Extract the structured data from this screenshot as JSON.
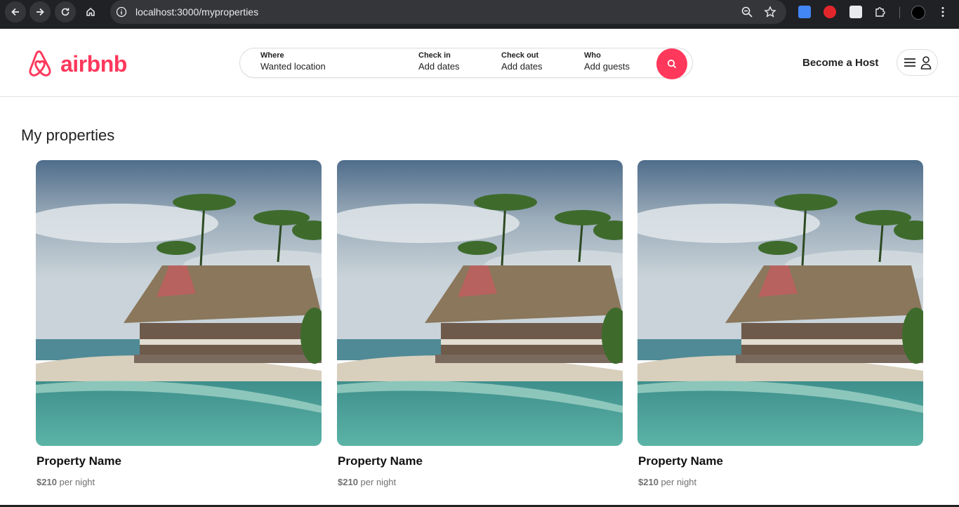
{
  "browser": {
    "url": "localhost:3000/myproperties"
  },
  "header": {
    "logo_text": "airbnb",
    "search": {
      "where_label": "Where",
      "where_value": "Wanted location",
      "checkin_label": "Check in",
      "checkin_value": "Add dates",
      "checkout_label": "Check out",
      "checkout_value": "Add dates",
      "who_label": "Who",
      "who_value": "Add guests"
    },
    "become_host": "Become a Host"
  },
  "main": {
    "title": "My properties",
    "properties": [
      {
        "name": "Property Name",
        "price": "$210",
        "per": "per night"
      },
      {
        "name": "Property Name",
        "price": "$210",
        "per": "per night"
      },
      {
        "name": "Property Name",
        "price": "$210",
        "per": "per night"
      }
    ]
  },
  "colors": {
    "brand": "#ff385c",
    "chrome": "#202124"
  }
}
